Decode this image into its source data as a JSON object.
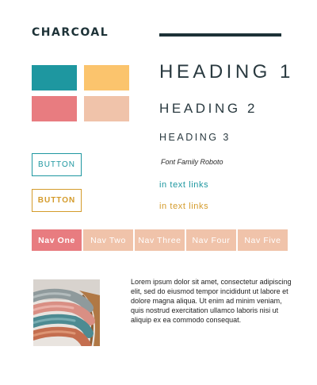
{
  "brand": {
    "logo": "CHARCOAL"
  },
  "colors": {
    "charcoal": "#1d3237",
    "teal": "#1e97a0",
    "yellow": "#fbc46d",
    "coral": "#e87c80",
    "peach": "#f0c3aa",
    "link_gold": "#d49b2b"
  },
  "headings": {
    "h1": "HEADING 1",
    "h2": "HEADING 2",
    "h3": "HEADING 3"
  },
  "typography": {
    "font_note": "Font Family Roboto"
  },
  "links": {
    "teal": "in text links",
    "gold": "in text links"
  },
  "buttons": {
    "primary": "BUTTON",
    "secondary": "BUTTON"
  },
  "nav": {
    "items": [
      "Nav One",
      "Nav Two",
      "Nav Three",
      "Nav Four",
      "Nav Five"
    ],
    "active": "Nav One"
  },
  "content": {
    "paragraph": "Lorem ipsum dolor sit amet, consectetur adipiscing elit, sed do eiusmod tempor incididunt ut labore et dolore magna aliqua. Ut enim ad minim veniam, quis nostrud exercitation ullamco laboris nisi ut aliquip ex ea commodo consequat.",
    "image_subject": "yarn-skeins-in-basket"
  }
}
